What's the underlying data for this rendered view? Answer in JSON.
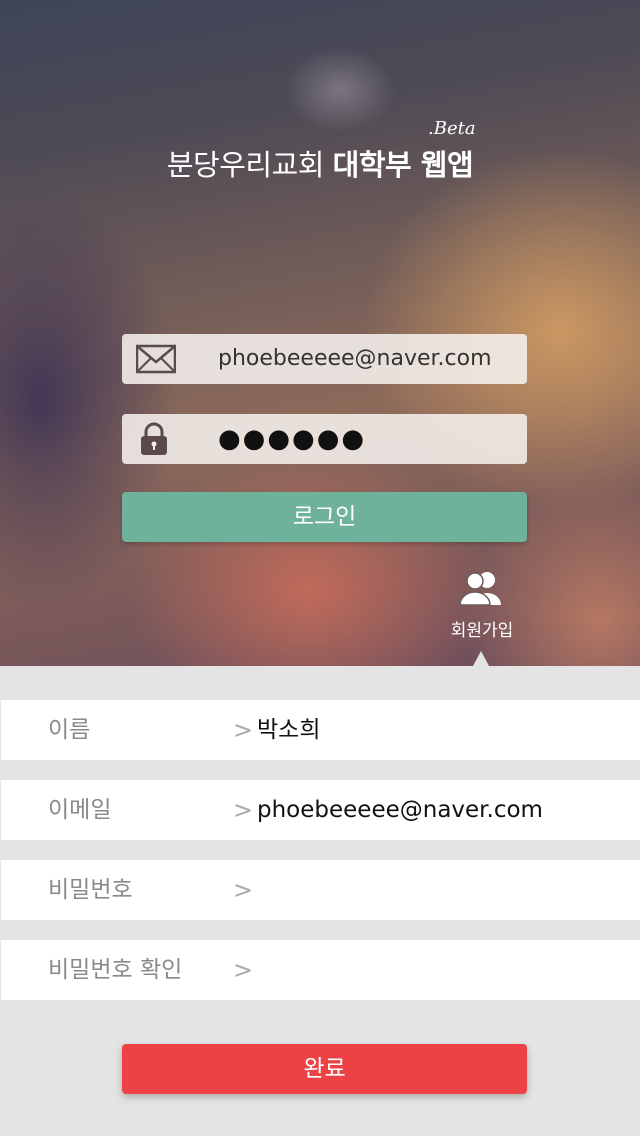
{
  "header": {
    "title_regular": "분당우리교회",
    "title_bold": "대학부 웹앱",
    "beta": ".Beta"
  },
  "login": {
    "email_value": "phoebeeeee@naver.com",
    "password_masked": "●●●●●●",
    "login_label": "로그인",
    "email_icon": "envelope-icon",
    "password_icon": "lock-icon"
  },
  "signup": {
    "label": "회원가입",
    "icon": "users-icon"
  },
  "form": {
    "rows": [
      {
        "label": "이름",
        "value": "박소희"
      },
      {
        "label": "이메일",
        "value": "phoebeeeee@naver.com"
      },
      {
        "label": "비밀번호",
        "value": ""
      },
      {
        "label": "비밀번호 확인",
        "value": ""
      }
    ],
    "chevron": ">",
    "done_label": "완료"
  },
  "colors": {
    "login_button": "#6fb29c",
    "done_button": "#ec4245",
    "form_background": "#e4e4e4"
  }
}
